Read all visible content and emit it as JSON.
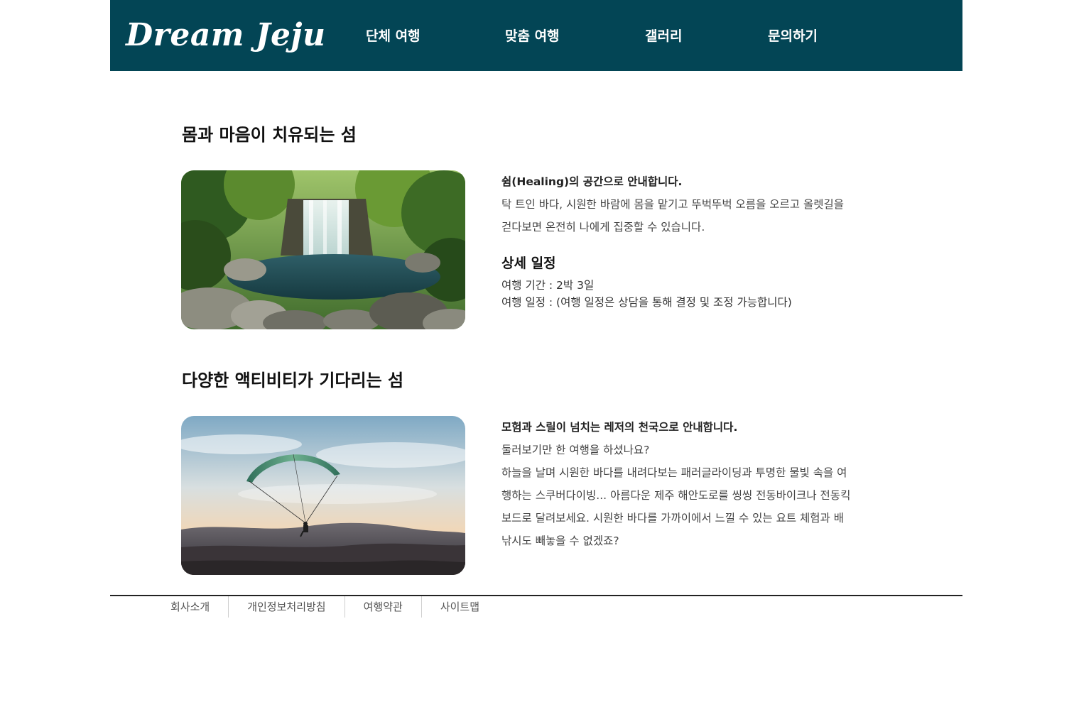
{
  "header": {
    "logo": "Dream Jeju",
    "nav": [
      {
        "label": "단체 여행"
      },
      {
        "label": "맞춤 여행"
      },
      {
        "label": "갤러리"
      },
      {
        "label": "문의하기"
      }
    ]
  },
  "sections": [
    {
      "title": "몸과 마음이 치유되는 섬",
      "image": "waterfall-image",
      "lead": "쉼(Healing)의 공간으로 안내합니다.",
      "paragraphs": [
        "탁 트인 바다, 시원한 바람에 몸을 맡기고 뚜벅뚜벅 오름을 오르고 올렛길을",
        "걷다보면 온전히 나에게 집중할 수 있습니다."
      ],
      "detail_title": "상세 일정",
      "details": [
        "여행 기간 : 2박 3일",
        "여행 일정 : (여행 일정은 상담을 통해 결정 및 조정 가능합니다)"
      ]
    },
    {
      "title": "다양한 액티비티가 기다리는 섬",
      "image": "paraglider-image",
      "lead": "모험과 스릴이 넘치는 레저의 천국으로 안내합니다.",
      "paragraphs": [
        "둘러보기만 한 여행을 하셨나요?",
        "하늘을 날며 시원한 바다를 내려다보는 패러글라이딩과 투명한 물빛 속을 여",
        "행하는 스쿠버다이빙... 아름다운 제주 해안도로를 씽씽 전동바이크나 전동킥",
        "보드로 달려보세요. 시원한 바다를 가까이에서 느낄 수 있는 요트 체험과 배",
        "낚시도 빼놓을 수 없겠죠?"
      ]
    }
  ],
  "footer": {
    "links": [
      {
        "label": "회사소개"
      },
      {
        "label": "개인정보처리방침"
      },
      {
        "label": "여행약관"
      },
      {
        "label": "사이트맵"
      }
    ]
  },
  "colors": {
    "header_bg": "#034555",
    "header_text": "#ffffff",
    "footer_rule": "#222222"
  }
}
